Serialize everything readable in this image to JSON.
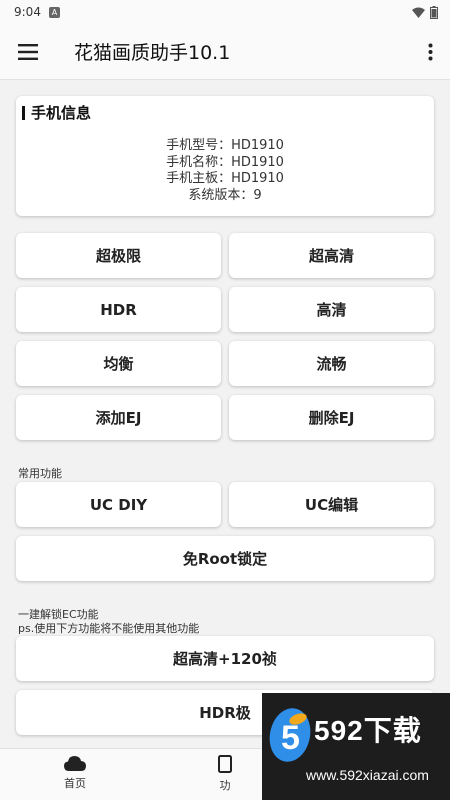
{
  "status_bar": {
    "time": "9:04",
    "notification_icon": "app-notification-icon",
    "wifi_icon": "wifi-icon",
    "battery_icon": "battery-icon"
  },
  "app_bar": {
    "title": "花猫画质助手10.1",
    "menu_icon": "hamburger-menu-icon",
    "more_icon": "more-vert-icon"
  },
  "info_card": {
    "title": "手机信息",
    "lines": [
      "手机型号：HD1910",
      "手机名称：HD1910",
      "手机主板：HD1910",
      "系统版本：9"
    ]
  },
  "quality_buttons": [
    "超极限",
    "超高清",
    "HDR",
    "高清",
    "均衡",
    "流畅",
    "添加EJ",
    "删除EJ"
  ],
  "common_section": {
    "label": "常用功能",
    "buttons": [
      "UC DIY",
      "UC编辑"
    ],
    "wide_button": "免Root锁定"
  },
  "unlock_section": {
    "label_line1": "一建解锁EC功能",
    "label_line2": "ps.使用下方功能将不能使用其他功能",
    "buttons": [
      "超高清+120祯",
      "HDR极"
    ]
  },
  "bottom_nav": [
    {
      "label": "首页",
      "icon": "cloud-icon"
    },
    {
      "label": "功",
      "icon": "tablet-icon"
    }
  ],
  "watermark": {
    "brand": "592下载",
    "url": "www.592xiazai.com",
    "logo_text": "5"
  },
  "colors": {
    "background": "#f2f2f2",
    "surface": "#ffffff",
    "watermark_bg": "#1d1d1d",
    "watermark_logo": "#2e8ee8"
  }
}
